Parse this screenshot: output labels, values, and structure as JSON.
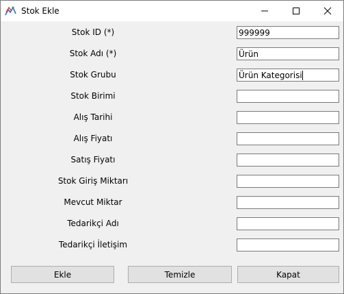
{
  "window": {
    "title": "Stok Ekle"
  },
  "form": {
    "fields": [
      {
        "label": "Stok ID (*)",
        "value": "999999"
      },
      {
        "label": "Stok Adı (*)",
        "value": "Ürün"
      },
      {
        "label": "Stok Grubu",
        "value": "Ürün Kategorisi"
      },
      {
        "label": "Stok Birimi",
        "value": ""
      },
      {
        "label": "Alış Tarihi",
        "value": ""
      },
      {
        "label": "Alış Fiyatı",
        "value": ""
      },
      {
        "label": "Satış Fiyatı",
        "value": ""
      },
      {
        "label": "Stok Giriş Miktarı",
        "value": ""
      },
      {
        "label": "Mevcut Miktar",
        "value": ""
      },
      {
        "label": "Tedarikçi Adı",
        "value": ""
      },
      {
        "label": "Tedarikçi İletişim",
        "value": ""
      }
    ]
  },
  "buttons": {
    "add_label": "Ekle",
    "clear_label": "Temizle",
    "close_label": "Kapat"
  }
}
